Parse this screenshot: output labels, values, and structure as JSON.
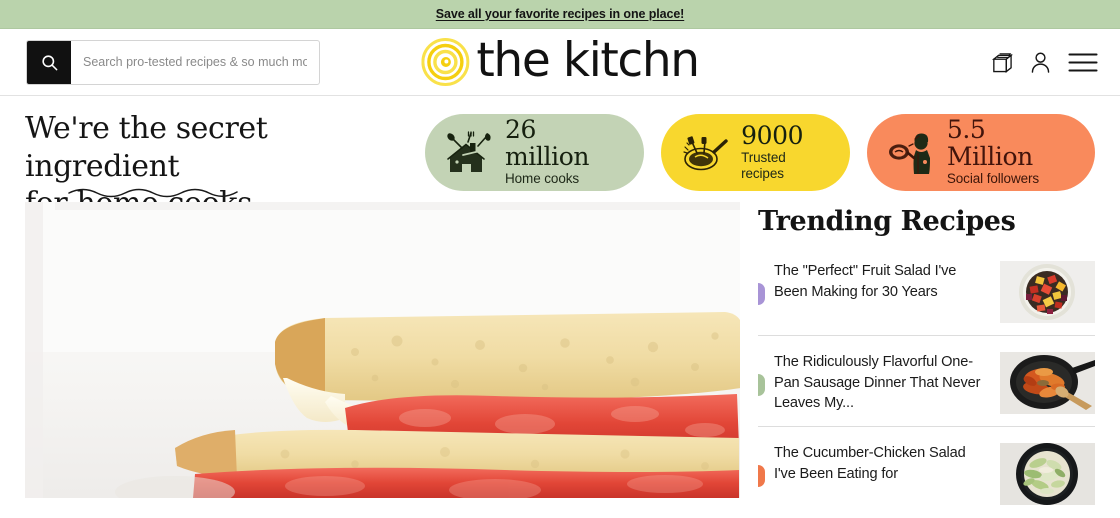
{
  "promo": {
    "text": "Save all your favorite recipes in one place!",
    "background": "#bad3ac"
  },
  "header": {
    "search": {
      "placeholder": "Search pro-tested recipes & so much more",
      "value": "",
      "icon": "search-icon"
    },
    "logo": {
      "text": "the kitchn",
      "mark": "spiral-logo-icon",
      "mark_color": "#f7d417"
    },
    "icons": [
      {
        "name": "recipe-box-icon",
        "label": "Recipe box"
      },
      {
        "name": "account-icon",
        "label": "Account"
      },
      {
        "name": "hamburger-menu-icon",
        "label": "Menu"
      }
    ]
  },
  "hero": {
    "headline_line1": "We're the secret ingredient",
    "headline_line2": "for home cooks.",
    "stats": [
      {
        "value": "26 million",
        "label": "Home cooks",
        "color": "#c3d3b5",
        "icon": "house-utensils-icon"
      },
      {
        "value": "9000",
        "label": "Trusted recipes",
        "color": "#f8d72e",
        "icon": "skillet-icon"
      },
      {
        "value": "5.5 Million",
        "label": "Social followers",
        "color": "#f98a5c",
        "icon": "food-photographer-icon"
      }
    ],
    "featured_image_alt": "Tomato sandwich on white bread"
  },
  "trending": {
    "title": "Trending Recipes",
    "items": [
      {
        "title": "The \"Perfect\" Fruit Salad I've Been Making for 30 Years",
        "bullet_color": "#a894d6",
        "thumb_alt": "Bowl of colorful fruit salad"
      },
      {
        "title": "The Ridiculously Flavorful One-Pan Sausage Dinner That Never Leaves My...",
        "bullet_color": "#a8c39a",
        "thumb_alt": "Cast iron skillet with sausage and peppers"
      },
      {
        "title": "The Cucumber-Chicken Salad I've Been Eating for",
        "bullet_color": "#f0784a",
        "thumb_alt": "Bowl of cucumber chicken salad"
      }
    ]
  }
}
